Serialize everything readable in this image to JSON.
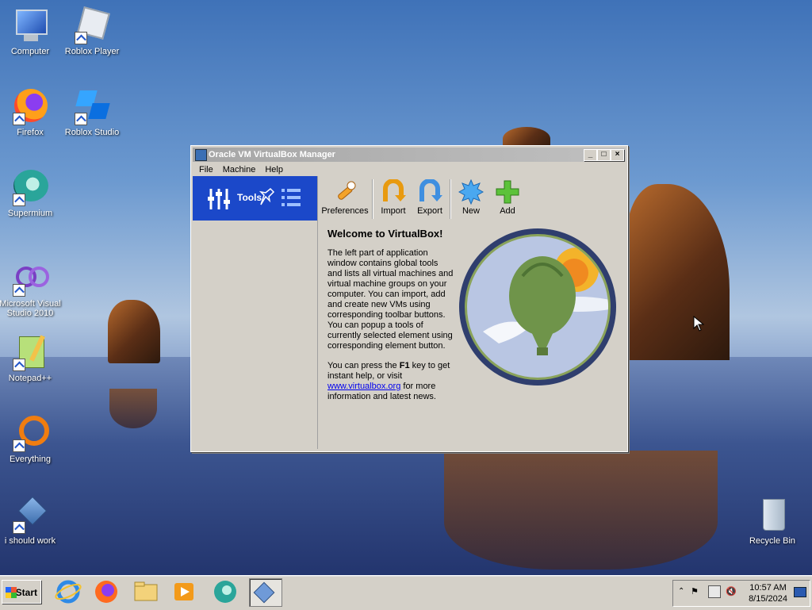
{
  "desktop": {
    "icons": [
      {
        "label": "Computer"
      },
      {
        "label": "Roblox Player"
      },
      {
        "label": "Firefox"
      },
      {
        "label": "Roblox Studio"
      },
      {
        "label": "Supermium"
      },
      {
        "label": "Microsoft Visual Studio 2010"
      },
      {
        "label": "Notepad++"
      },
      {
        "label": "Everything"
      },
      {
        "label": "i should work"
      },
      {
        "label": "Recycle Bin"
      }
    ]
  },
  "window": {
    "title": "Oracle VM VirtualBox Manager",
    "menu": [
      "File",
      "Machine",
      "Help"
    ],
    "left_pane": {
      "tools_label": "Tools"
    },
    "toolbar": [
      {
        "label": "Preferences",
        "icon": "wrench-icon"
      },
      {
        "label": "Import",
        "icon": "import-arrow-icon"
      },
      {
        "label": "Export",
        "icon": "export-arrow-icon"
      },
      {
        "label": "New",
        "icon": "new-vm-icon"
      },
      {
        "label": "Add",
        "icon": "add-plus-icon"
      }
    ],
    "welcome": {
      "heading": "Welcome to VirtualBox!",
      "para1": "The left part of application window contains global tools and lists all virtual machines and virtual machine groups on your computer. You can import, add and create new VMs using corresponding toolbar buttons. You can popup a tools of currently selected element using corresponding element button.",
      "para2_before": "You can press the ",
      "para2_key": "F1",
      "para2_middle": " key to get instant help, or visit ",
      "link": "www.virtualbox.org",
      "para2_after": " for more information and latest news."
    }
  },
  "taskbar": {
    "start_label": "Start",
    "clock_time": "10:57 AM",
    "clock_date": "8/15/2024"
  },
  "colors": {
    "selection": "#1b48c9",
    "window_face": "#d4d0c8",
    "link": "#0000ee"
  }
}
